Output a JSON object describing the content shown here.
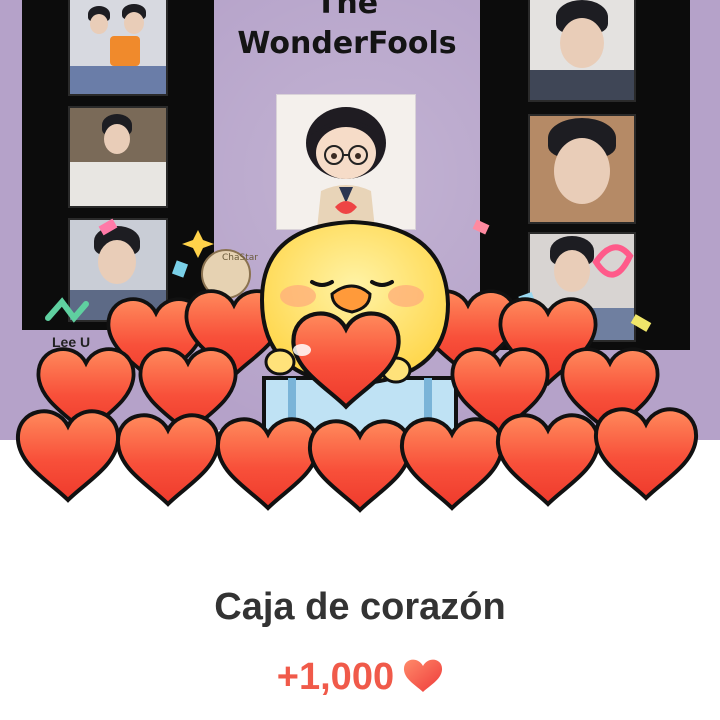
{
  "background_card": {
    "title_line1": "The",
    "title_line2": "WonderFools",
    "caption_left": "Lee U",
    "sticker_text": "ChaStar"
  },
  "gift": {
    "name": "Caja de corazón",
    "value": "+1,000",
    "icon": "heart-icon",
    "accent_color": "#f05a4a"
  }
}
